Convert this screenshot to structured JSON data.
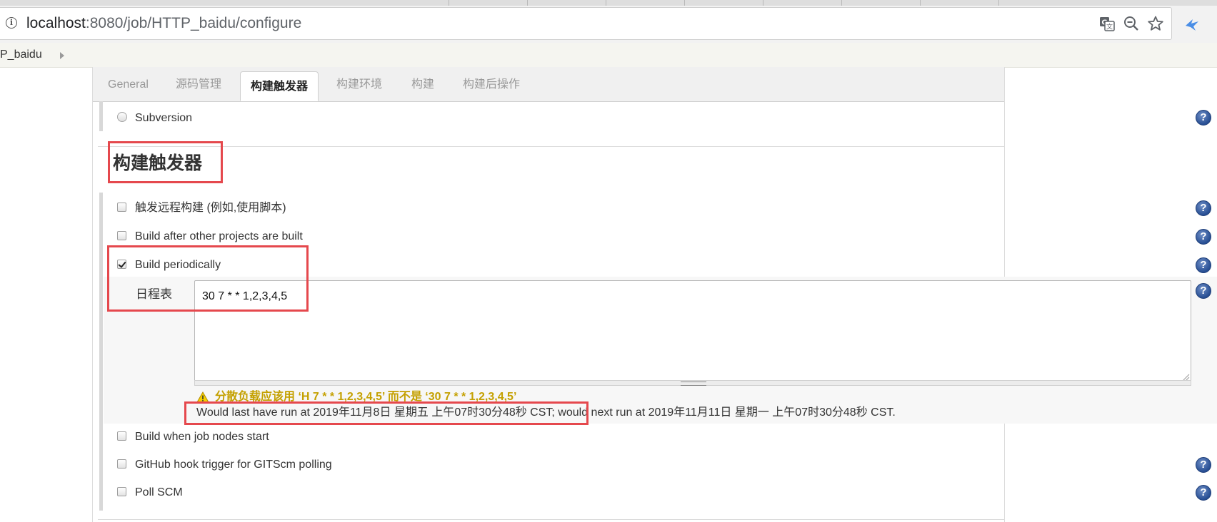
{
  "browser": {
    "url_host": "localhost",
    "url_path": ":8080/job/HTTP_baidu/configure"
  },
  "breadcrumb": {
    "item": "P_baidu"
  },
  "config_tabs": [
    {
      "label": "General"
    },
    {
      "label": "源码管理"
    },
    {
      "label": "构建触发器"
    },
    {
      "label": "构建环境"
    },
    {
      "label": "构建"
    },
    {
      "label": "构建后操作"
    }
  ],
  "active_tab": "构建触发器",
  "scm": {
    "subversion_label": "Subversion",
    "subversion_selected": false
  },
  "triggers_section": {
    "title": "构建触发器",
    "options": [
      {
        "label": "触发远程构建 (例如,使用脚本)",
        "checked": false
      },
      {
        "label": "Build after other projects are built",
        "checked": false
      },
      {
        "label": "Build periodically",
        "checked": true
      },
      {
        "label": "Build when job nodes start",
        "checked": false
      },
      {
        "label": "GitHub hook trigger for GITScm polling",
        "checked": false
      },
      {
        "label": "Poll SCM",
        "checked": false
      }
    ],
    "schedule_label": "日程表",
    "schedule_value": "30 7 * * 1,2,3,4,5",
    "warning": "分散负载应该用 ‘H 7 * * 1,2,3,4,5’ 而不是 ‘30 7 * * 1,2,3,4,5’",
    "status": "Would last have run at 2019年11月8日 星期五 上午07时30分48秒 CST; would next run at 2019年11月11日 星期一 上午07时30分48秒 CST."
  },
  "help_icon_glyph": "?",
  "colors": {
    "highlight": "#e5484d",
    "warning": "#c4a000",
    "help": "#274e93"
  }
}
